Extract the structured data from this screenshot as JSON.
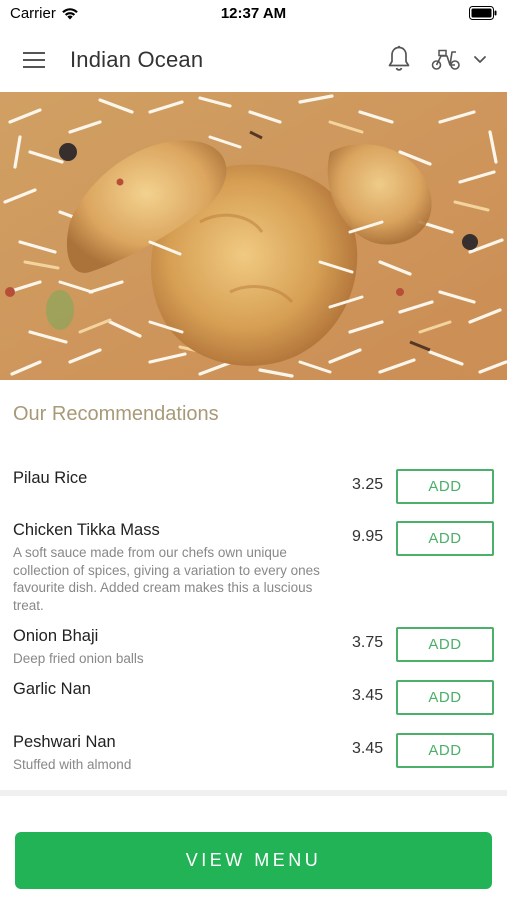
{
  "status_bar": {
    "carrier": "Carrier",
    "time": "12:37 AM",
    "wifi_icon": "wifi-icon",
    "battery_icon": "battery-icon"
  },
  "header": {
    "title": "Indian Ocean",
    "menu_icon": "hamburger-icon",
    "bell_icon": "bell-icon",
    "delivery_icon": "scooter-icon",
    "dropdown_icon": "chevron-down-icon"
  },
  "hero": {
    "image": "biryani-photo"
  },
  "recommendations": {
    "title": "Our Recommendations",
    "items": [
      {
        "name": "Pilau Rice",
        "description": "",
        "price": "3.25",
        "add_label": "ADD"
      },
      {
        "name": "Chicken Tikka Mass",
        "description": "A soft sauce made from our chefs own unique collection of spices, giving a variation to every ones favourite dish. Added cream makes this a luscious treat.",
        "price": "9.95",
        "add_label": "ADD"
      },
      {
        "name": "Onion Bhaji",
        "description": "Deep fried onion balls",
        "price": "3.75",
        "add_label": "ADD"
      },
      {
        "name": "Garlic Nan",
        "description": "",
        "price": "3.45",
        "add_label": "ADD"
      },
      {
        "name": "Peshwari Nan",
        "description": "Stuffed with almond",
        "price": "3.45",
        "add_label": "ADD"
      }
    ]
  },
  "footer": {
    "view_menu_label": "VIEW MENU"
  },
  "colors": {
    "accent_green": "#22b356",
    "add_border_green": "#4caf6a",
    "section_title": "#a89a78"
  }
}
